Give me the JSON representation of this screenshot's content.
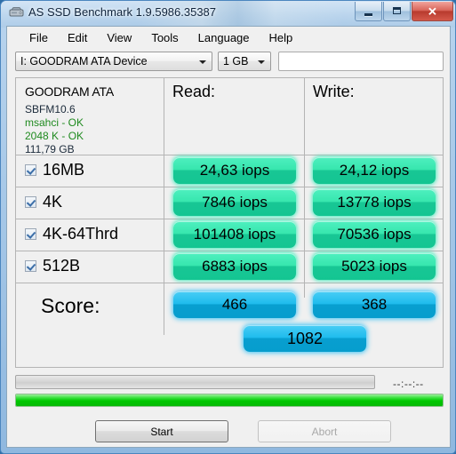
{
  "window": {
    "title": "AS SSD Benchmark 1.9.5986.35387",
    "icon": "hard-drive-icon",
    "buttons": {
      "minimize": "minimize-icon",
      "maximize": "maximize-icon",
      "close": "✕"
    }
  },
  "menu": {
    "items": [
      "File",
      "Edit",
      "View",
      "Tools",
      "Language",
      "Help"
    ]
  },
  "toolbar": {
    "drive_select": "I: GOODRAM ATA Device",
    "size_select": "1 GB",
    "text_field_value": "",
    "text_field_placeholder": ""
  },
  "drive_info": {
    "model": "GOODRAM ATA",
    "firmware": "SBFM10.6",
    "driver": "msahci - OK",
    "alignment": "2048 K - OK",
    "capacity": "111,79 GB"
  },
  "columns": {
    "read": "Read:",
    "write": "Write:"
  },
  "tests": [
    {
      "name": "16MB",
      "checked": true,
      "read": "24,63 iops",
      "write": "24,12 iops"
    },
    {
      "name": "4K",
      "checked": true,
      "read": "7846 iops",
      "write": "13778 iops"
    },
    {
      "name": "4K-64Thrd",
      "checked": true,
      "read": "101408 iops",
      "write": "70536 iops"
    },
    {
      "name": "512B",
      "checked": true,
      "read": "6883 iops",
      "write": "5023 iops"
    }
  ],
  "score": {
    "label": "Score:",
    "read": "466",
    "write": "368",
    "total": "1082"
  },
  "progress": {
    "top_percent": 0,
    "bottom_percent": 100,
    "timer": "--:--:--"
  },
  "footer": {
    "start": "Start",
    "abort": "Abort",
    "abort_disabled": true
  },
  "colors": {
    "result_green": "#22d79e",
    "score_blue": "#10ade0",
    "ok_green": "#1f8a1f",
    "progress_green": "#00c800"
  }
}
